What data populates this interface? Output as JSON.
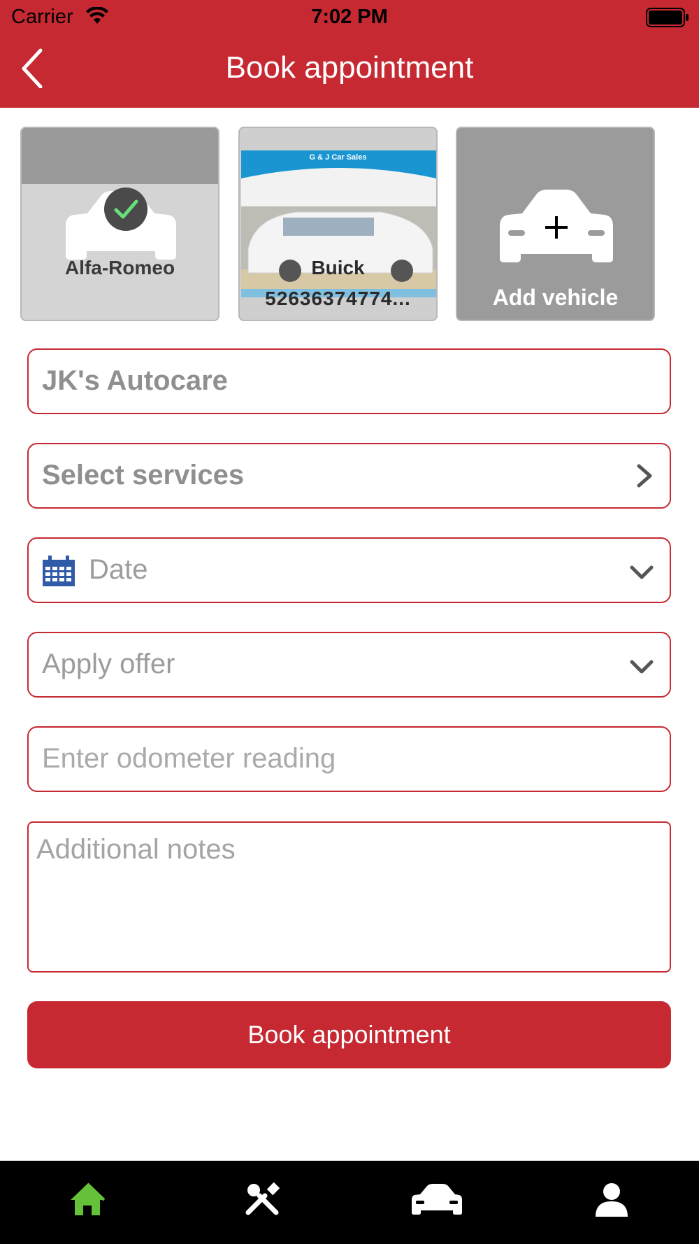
{
  "status_bar": {
    "carrier": "Carrier",
    "time": "7:02 PM"
  },
  "header": {
    "title": "Book appointment"
  },
  "vehicles": [
    {
      "name": "Alfa-Romeo",
      "selected": true,
      "subtitle": ""
    },
    {
      "name": "Buick",
      "subtitle": "52636374774..."
    },
    {
      "name": "Add vehicle"
    }
  ],
  "form": {
    "shop": "JK's Autocare",
    "services": "Select services",
    "date": "Date",
    "offer": "Apply offer",
    "odometer_placeholder": "Enter odometer reading",
    "notes_placeholder": "Additional notes"
  },
  "book_button": "Book appointment",
  "colors": {
    "brand": "#c62931",
    "active_tab": "#66c13a"
  },
  "tabs": [
    {
      "icon": "home-icon",
      "active": true
    },
    {
      "icon": "tools-icon"
    },
    {
      "icon": "car-icon"
    },
    {
      "icon": "profile-icon"
    }
  ],
  "buick_photo_banner": "G & J Car Sales"
}
